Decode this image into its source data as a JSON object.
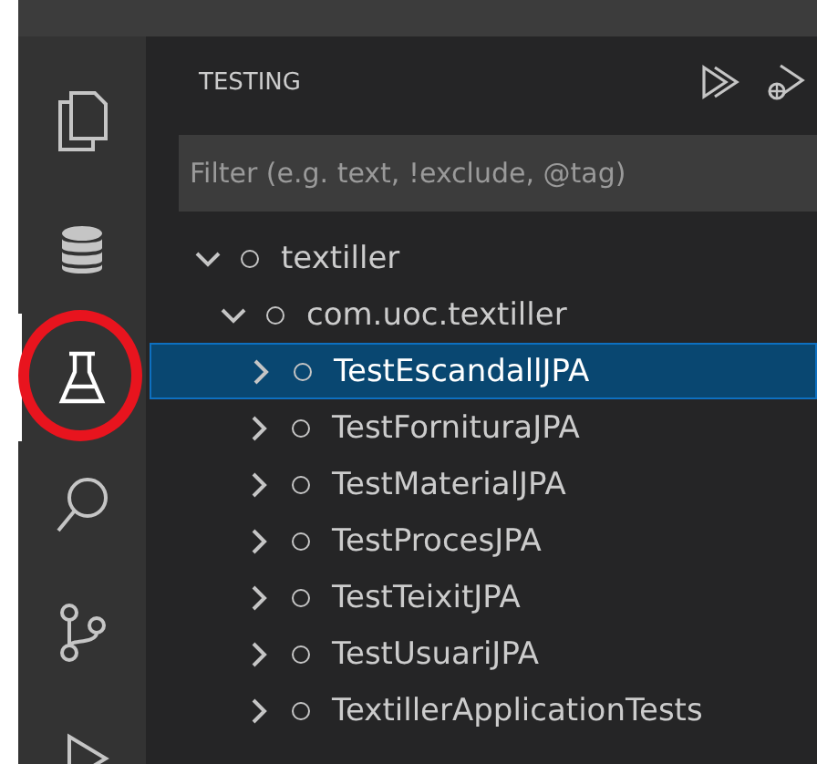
{
  "activity_bar": [
    {
      "kind": "explorer",
      "selected": false,
      "circled": false
    },
    {
      "kind": "database",
      "selected": false,
      "circled": false
    },
    {
      "kind": "testing",
      "selected": true,
      "circled": true
    },
    {
      "kind": "search",
      "selected": false,
      "circled": false
    },
    {
      "kind": "source_control",
      "selected": false,
      "circled": false
    },
    {
      "kind": "run",
      "selected": false,
      "circled": false
    }
  ],
  "panel": {
    "title": "TESTING",
    "actions": [
      {
        "kind": "run_all"
      },
      {
        "kind": "debug_all"
      }
    ],
    "filter": {
      "placeholder": "Filter (e.g. text, !exclude, @tag)"
    },
    "tree": [
      {
        "label": "textiller",
        "expanded": true,
        "selected": false,
        "children": [
          {
            "label": "com.uoc.textiller",
            "expanded": true,
            "selected": false,
            "children": [
              {
                "label": "TestEscandallJPA",
                "expanded": false,
                "selected": true
              },
              {
                "label": "TestFornituraJPA",
                "expanded": false,
                "selected": false
              },
              {
                "label": "TestMaterialJPA",
                "expanded": false,
                "selected": false
              },
              {
                "label": "TestProcesJPA",
                "expanded": false,
                "selected": false
              },
              {
                "label": "TestTeixitJPA",
                "expanded": false,
                "selected": false
              },
              {
                "label": "TestUsuariJPA",
                "expanded": false,
                "selected": false
              },
              {
                "label": "TextillerApplicationTests",
                "expanded": false,
                "selected": false
              }
            ]
          }
        ]
      }
    ]
  }
}
